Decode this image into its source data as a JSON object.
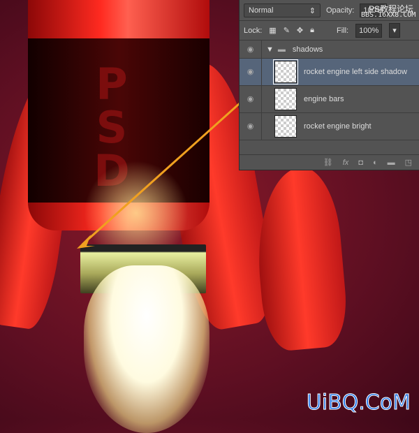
{
  "artwork": {
    "letters": [
      "P",
      "S",
      "D"
    ]
  },
  "layers_panel": {
    "blend_mode": "Normal",
    "opacity_label": "Opacity:",
    "opacity_value": "100%",
    "lock_label": "Lock:",
    "fill_label": "Fill:",
    "fill_value": "100%",
    "group": "shadows",
    "layers": [
      {
        "name": "rocket engine left side shadow",
        "selected": true
      },
      {
        "name": "engine bars"
      },
      {
        "name": "rocket engine bright"
      }
    ]
  },
  "watermark": {
    "line1": "PS教程论坛",
    "line2": "BBS.16XX8.COM",
    "logo": "UiBQ.CoM"
  },
  "colors": {
    "arrow": "#f0a020",
    "selection": "#56657a"
  }
}
